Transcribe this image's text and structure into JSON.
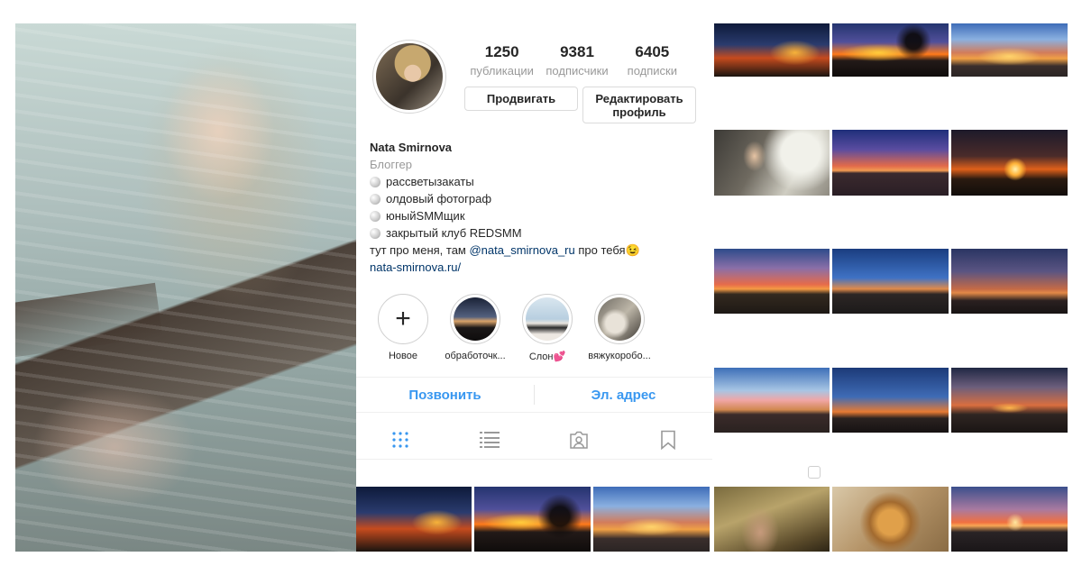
{
  "profile": {
    "stats": [
      {
        "value": "1250",
        "label": "публикации"
      },
      {
        "value": "9381",
        "label": "подписчики"
      },
      {
        "value": "6405",
        "label": "подписки"
      }
    ],
    "buttons": {
      "promote": "Продвигать",
      "edit": "Редактировать профиль"
    },
    "name": "Nata Smirnova",
    "category": "Блоггер",
    "bio_lines": [
      "рассветызакаты",
      "олдовый фотограф",
      "юныйSMMщик",
      "закрытый клуб REDSMM"
    ],
    "about_prefix": "тут про меня, там ",
    "mention": "@nata_smirnova_ru",
    "about_suffix": " про тебя😉",
    "website": "nata-smirnova.ru/"
  },
  "highlights": [
    {
      "label": "Новое",
      "icon": "plus-icon"
    },
    {
      "label": "обработочк..."
    },
    {
      "label": "Слон💕"
    },
    {
      "label": "вяжукоробо..."
    }
  ],
  "contact": {
    "call": "Позвонить",
    "email": "Эл. адрес"
  },
  "tabs": [
    {
      "icon": "grid-icon",
      "active": true
    },
    {
      "icon": "list-icon",
      "active": false
    },
    {
      "icon": "tagged-icon",
      "active": false
    },
    {
      "icon": "bookmark-icon",
      "active": false
    }
  ],
  "colors": {
    "accent": "#3897f0",
    "link": "#003569",
    "muted": "#999999",
    "text": "#262626",
    "border": "#dbdbdb"
  }
}
